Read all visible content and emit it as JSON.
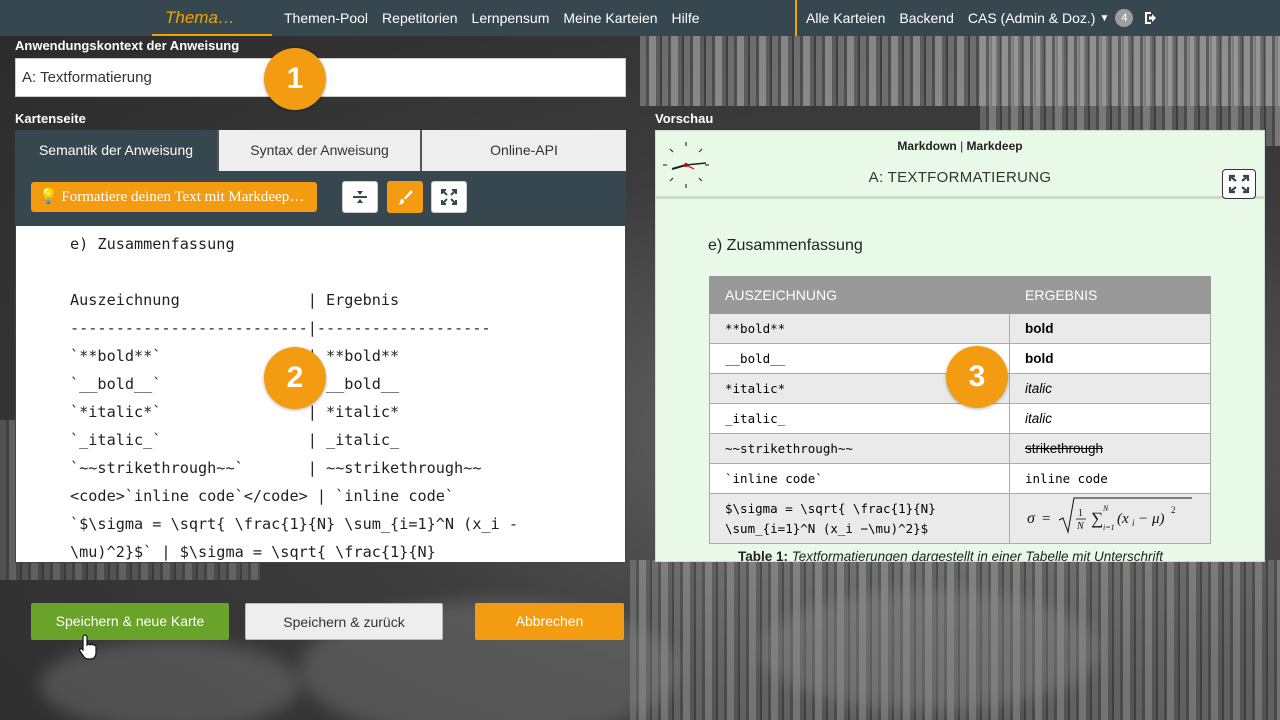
{
  "nav": {
    "brand": "Thema…",
    "left_items": [
      "Themen-Pool",
      "Repetitorien",
      "Lernpensum",
      "Meine Karteien",
      "Hilfe"
    ],
    "right_items": [
      "Alle Karteien",
      "Backend"
    ],
    "user": "CAS (Admin & Doz.)",
    "badge": "4",
    "logout_icon": "logout-icon"
  },
  "form": {
    "context_label": "Anwendungskontext der Anweisung",
    "context_value": "A: Textformatierung",
    "card_side_label": "Kartenseite",
    "preview_label": "Vorschau"
  },
  "markers": {
    "one": "1",
    "two": "2",
    "three": "3"
  },
  "editor": {
    "tabs": [
      {
        "label": "Semantik der Anweisung",
        "active": true
      },
      {
        "label": "Syntax der Anweisung",
        "active": false
      },
      {
        "label": "Online-API",
        "active": false
      }
    ],
    "hint_button": "💡 Formatiere deinen Text mit Markdeep…",
    "tool_icons": [
      "compress-vertical-icon",
      "paintbrush-icon",
      "fullscreen-icon"
    ],
    "lines": [
      "e) Zusammenfassung",
      "",
      "Auszeichnung              | Ergebnis",
      "--------------------------|-------------------",
      "`**bold**`                | **bold**",
      "`__bold__`                | __bold__",
      "`*italic*`                | *italic*",
      "`_italic_`                | _italic_",
      "`~~strikethrough~~`       | ~~strikethrough~~",
      "<code>`inline code`</code> | `inline code`",
      "`$\\sigma = \\sqrt{ \\frac{1}{N} \\sum_{i=1}^N (x_i -",
      "\\mu)^2}$` | $\\sigma = \\sqrt{ \\frac{1}{N}"
    ]
  },
  "preview": {
    "render_mode_a": "Markdown",
    "render_mode_sep": " | ",
    "render_mode_b": "Markdeep",
    "title": "A: TEXTFORMATIERUNG",
    "section_heading": "e) Zusammenfassung",
    "table_headers": [
      "AUSZEICHNUNG",
      "ERGEBNIS"
    ],
    "rows": [
      {
        "markup": "**bold**",
        "result": "bold",
        "style": "bold"
      },
      {
        "markup": "__bold__",
        "result": "bold",
        "style": "bold"
      },
      {
        "markup": "*italic*",
        "result": "italic",
        "style": "italic"
      },
      {
        "markup": "_italic_",
        "result": "italic",
        "style": "italic"
      },
      {
        "markup": "~~strikethrough~~",
        "result": "strikethrough",
        "style": "strike"
      },
      {
        "markup": "`inline code`",
        "result": "inline code",
        "style": "code"
      }
    ],
    "formula_markup_1": "$\\sigma = \\sqrt{ \\frac{1}{N}",
    "formula_markup_2": "\\sum_{i=1}^N (x_i −\\mu)^2}$",
    "caption_label": "Table 1:",
    "caption_text": "Textformatierungen dargestellt in einer Tabelle mit Unterschrift"
  },
  "buttons": {
    "save_new": "Speichern & neue Karte",
    "save_back": "Speichern & zurück",
    "cancel": "Abbrechen"
  },
  "colors": {
    "nav_bg": "#37474f",
    "accent": "#f39c12",
    "green": "#6aa32a",
    "preview_bg": "#e8f9e8"
  }
}
